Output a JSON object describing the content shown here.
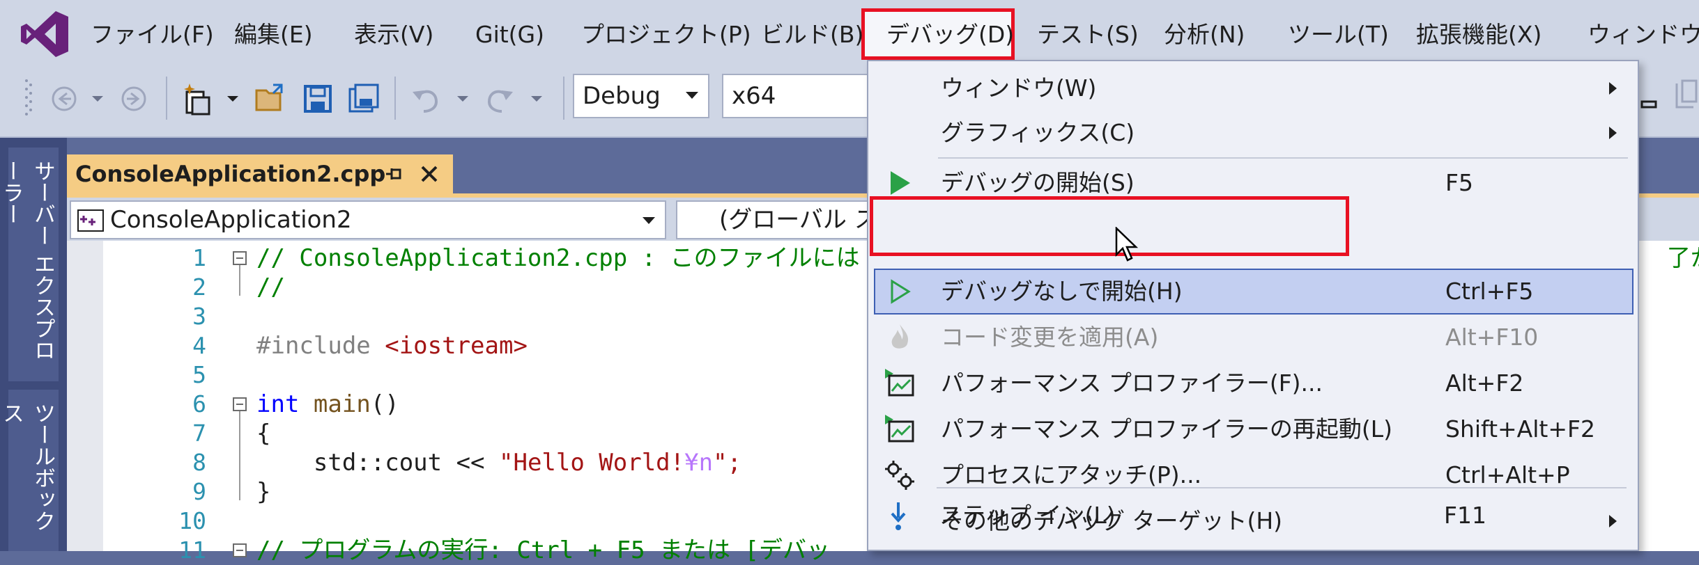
{
  "menubar": {
    "items": [
      {
        "label": "ファイル(F)"
      },
      {
        "label": "編集(E)"
      },
      {
        "label": "表示(V)"
      },
      {
        "label": "Git(G)"
      },
      {
        "label": "プロジェクト(P)"
      },
      {
        "label": "ビルド(B)"
      },
      {
        "label": "デバッグ(D)"
      },
      {
        "label": "テスト(S)"
      },
      {
        "label": "分析(N)"
      },
      {
        "label": "ツール(T)"
      },
      {
        "label": "拡張機能(X)"
      },
      {
        "label": "ウィンドウ(W)"
      }
    ]
  },
  "toolbar": {
    "configuration": "Debug",
    "platform": "x64"
  },
  "sidebar": {
    "tabs": [
      {
        "label": "サーバー エクスプローラー"
      },
      {
        "label": "ツールボックス"
      }
    ]
  },
  "document_tab": {
    "title": "ConsoleApplication2.cpp"
  },
  "navbar": {
    "project": "ConsoleApplication2",
    "scope": "(グローバル スコ"
  },
  "editor": {
    "line_numbers": [
      "1",
      "2",
      "3",
      "4",
      "5",
      "6",
      "7",
      "8",
      "9",
      "10",
      "11"
    ],
    "line1_comment": "// ConsoleApplication2.cpp : このファイルには",
    "line1_tail": "了が",
    "line2_comment": "//",
    "line4_pre": "#include ",
    "line4_inc": "<iostream>",
    "line6_kw": "int",
    "line6_fn": "main",
    "line6_rest": "()",
    "line7": "{",
    "line8_pre": "    std::cout << ",
    "line8_str": "\"Hello World!",
    "line8_esc": "¥n",
    "line8_end": "\";",
    "line9": "}",
    "line11_comment": "// プログラムの実行: Ctrl + F5 または [デバッ"
  },
  "debug_menu": {
    "items": [
      {
        "label": "ウィンドウ(W)",
        "shortcut": ""
      },
      {
        "label": "グラフィックス(C)",
        "shortcut": ""
      },
      {
        "label": "デバッグの開始(S)",
        "shortcut": "F5"
      },
      {
        "label": "デバッグなしで開始(H)",
        "shortcut": "Ctrl+F5"
      },
      {
        "label": "コード変更を適用(A)",
        "shortcut": "Alt+F10"
      },
      {
        "label": "パフォーマンス プロファイラー(F)...",
        "shortcut": "Alt+F2"
      },
      {
        "label": "パフォーマンス プロファイラーの再起動(L)",
        "shortcut": "Shift+Alt+F2"
      },
      {
        "label": "プロセスにアタッチ(P)...",
        "shortcut": "Ctrl+Alt+P"
      },
      {
        "label": "その他のデバッグ ターゲット(H)",
        "shortcut": ""
      },
      {
        "label": "ステップ イン(L)",
        "shortcut": "F11"
      }
    ]
  },
  "colors": {
    "accent_purple": "#68217a",
    "highlight_red": "#e81123",
    "tab_active": "#f5cc84",
    "run_green": "#2aa147"
  }
}
